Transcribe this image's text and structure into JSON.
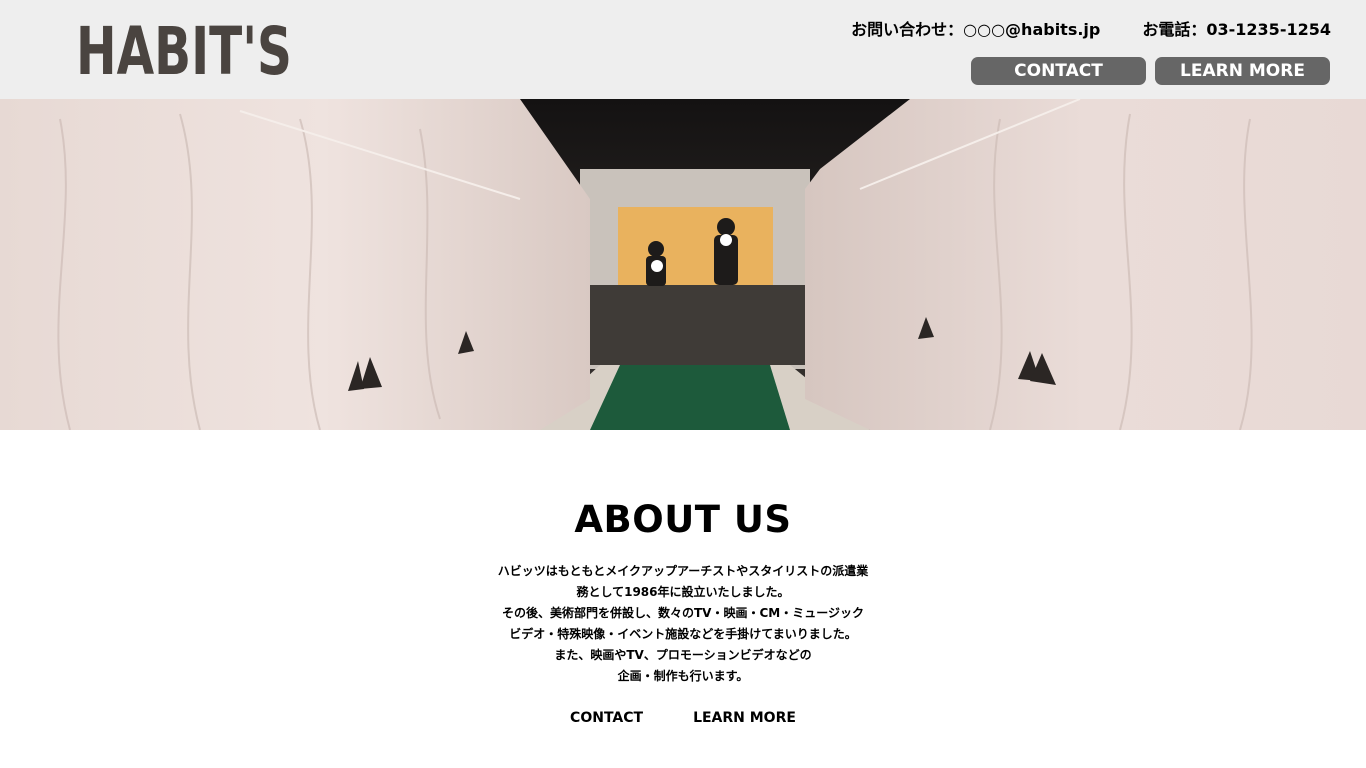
{
  "header": {
    "logo_text": "HABIT'S",
    "email_label": "お問い合わせ：○○○@habits.jp",
    "phone_label": "お電話：03-1235-1254",
    "contact_button": "CONTACT",
    "learn_more_button": "LEARN MORE"
  },
  "hero": {
    "icon": "ninja-range-photo"
  },
  "about": {
    "title": "ABOUT US",
    "lines": [
      "ハビッツはもともとメイクアップアーチストやスタイリストの派遣業",
      "務として1986年に設立いたしました。",
      "その後、美術部門を併設し、数々のTV・映画・CM・ミュージック",
      "ビデオ・特殊映像・イベント施設などを手掛けてまいりました。",
      "また、映画やTV、プロモーションビデオなどの",
      "企画・制作も行います。"
    ],
    "contact_link": "CONTACT",
    "learn_more_link": "LEARN MORE"
  },
  "colors": {
    "header_bg": "#eeeeee",
    "button_bg": "#666666",
    "logo": "#4a4440"
  }
}
